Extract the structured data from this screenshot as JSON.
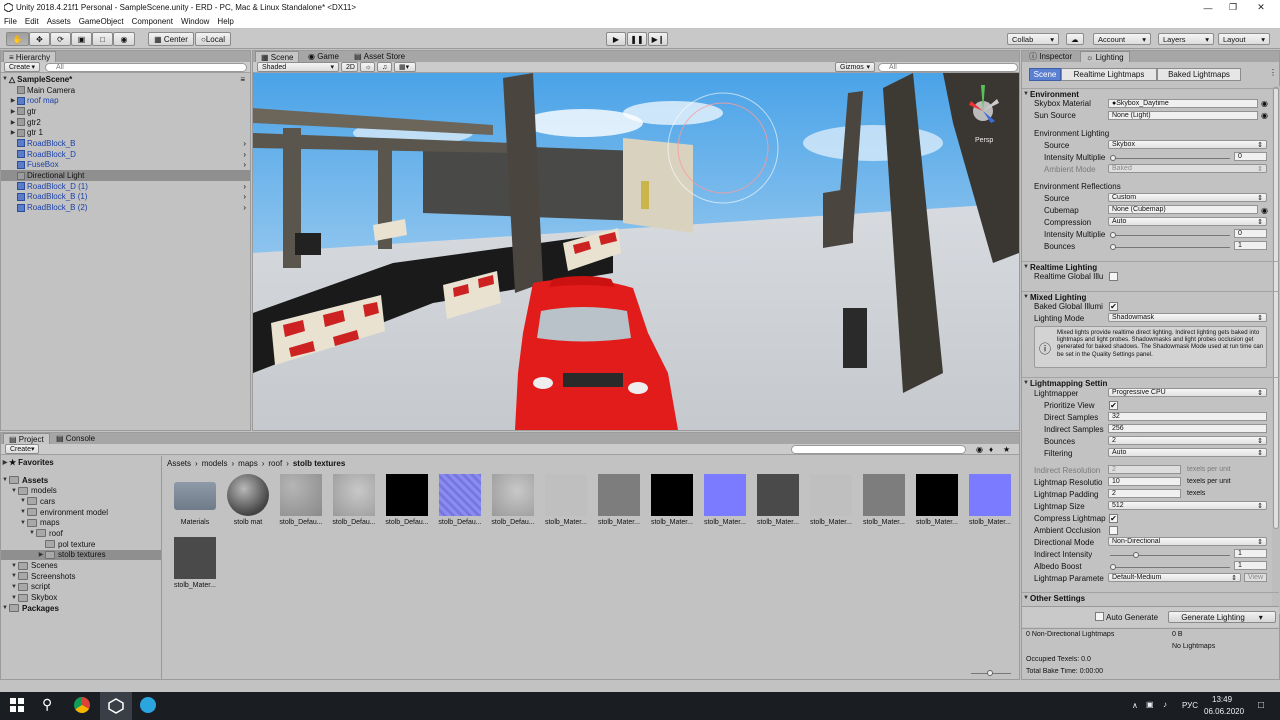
{
  "window": {
    "title": "Unity 2018.4.21f1 Personal - SampleScene.unity - ERD - PC, Mac & Linux Standalone* <DX11>"
  },
  "menu": [
    "File",
    "Edit",
    "Assets",
    "GameObject",
    "Component",
    "Window",
    "Help"
  ],
  "toolbar": {
    "pivot": "Center",
    "space": "Local",
    "collab": "Collab",
    "account": "Account",
    "layers": "Layers",
    "layout": "Layout"
  },
  "hierarchy": {
    "tab": "Hierarchy",
    "create": "Create",
    "search_placeholder": "All",
    "scene": "SampleScene*",
    "items": [
      {
        "label": "Main Camera",
        "type": "object",
        "arrow": false,
        "chevron": false
      },
      {
        "label": "roof map",
        "type": "prefab",
        "arrow": true,
        "chevron": false
      },
      {
        "label": "gtr",
        "type": "object",
        "arrow": true,
        "chevron": false
      },
      {
        "label": "gtr2",
        "type": "object",
        "arrow": true,
        "chevron": false
      },
      {
        "label": "gtr 1",
        "type": "object",
        "arrow": true,
        "chevron": false
      },
      {
        "label": "RoadBlock_B",
        "type": "prefab",
        "arrow": false,
        "chevron": true
      },
      {
        "label": "RoadBlock_D",
        "type": "prefab",
        "arrow": false,
        "chevron": true
      },
      {
        "label": "FuseBox",
        "type": "prefab",
        "arrow": false,
        "chevron": true
      },
      {
        "label": "Directional Light",
        "type": "object",
        "arrow": false,
        "chevron": false,
        "selected": true
      },
      {
        "label": "RoadBlock_D (1)",
        "type": "prefab",
        "arrow": false,
        "chevron": true
      },
      {
        "label": "RoadBlock_B (1)",
        "type": "prefab",
        "arrow": false,
        "chevron": true
      },
      {
        "label": "RoadBlock_B (2)",
        "type": "prefab",
        "arrow": false,
        "chevron": true
      }
    ]
  },
  "scene_view": {
    "tabs": [
      "Scene",
      "Game",
      "Asset Store"
    ],
    "shading": "Shaded",
    "mode_2d": "2D",
    "gizmos": "Gizmos",
    "search_placeholder": "All",
    "persp": "Persp"
  },
  "project": {
    "tabs": [
      "Project",
      "Console"
    ],
    "create": "Create",
    "favorites": "Favorites",
    "tree": [
      {
        "label": "Assets",
        "depth": 0,
        "bold": true
      },
      {
        "label": "models",
        "depth": 1
      },
      {
        "label": "cars",
        "depth": 2
      },
      {
        "label": "environment model",
        "depth": 2
      },
      {
        "label": "maps",
        "depth": 2
      },
      {
        "label": "roof",
        "depth": 3
      },
      {
        "label": "pol texture",
        "depth": 4
      },
      {
        "label": "stolb textures",
        "depth": 4,
        "selected": true
      },
      {
        "label": "Scenes",
        "depth": 1
      },
      {
        "label": "Screenshots",
        "depth": 1
      },
      {
        "label": "script",
        "depth": 1
      },
      {
        "label": "Skybox",
        "depth": 1
      },
      {
        "label": "Packages",
        "depth": 0,
        "bold": true
      }
    ],
    "breadcrumb": [
      "Assets",
      "models",
      "maps",
      "roof",
      "stolb textures"
    ],
    "assets": [
      {
        "label": "Materials",
        "kind": "folder"
      },
      {
        "label": "stolb mat",
        "kind": "sphere"
      },
      {
        "label": "stolb_Defau...",
        "kind": "tx"
      },
      {
        "label": "stolb_Defau...",
        "kind": "tx2"
      },
      {
        "label": "stolb_Defau...",
        "kind": "blk"
      },
      {
        "label": "stolb_Defau...",
        "kind": "nrmt"
      },
      {
        "label": "stolb_Defau...",
        "kind": "tx2"
      },
      {
        "label": "stolb_Mater...",
        "kind": "lg"
      },
      {
        "label": "stolb_Mater...",
        "kind": "mg"
      },
      {
        "label": "stolb_Mater...",
        "kind": "blk"
      },
      {
        "label": "stolb_Mater...",
        "kind": "nrm"
      },
      {
        "label": "stolb_Mater...",
        "kind": "dg"
      },
      {
        "label": "stolb_Mater...",
        "kind": "lg"
      },
      {
        "label": "stolb_Mater...",
        "kind": "mg"
      },
      {
        "label": "stolb_Mater...",
        "kind": "blk"
      },
      {
        "label": "stolb_Mater...",
        "kind": "nrm"
      },
      {
        "label": "stolb_Mater...",
        "kind": "dg"
      }
    ]
  },
  "inspector": {
    "tabs": [
      "Inspector",
      "Lighting"
    ],
    "subtabs": [
      "Scene",
      "Realtime Lightmaps",
      "Baked Lightmaps"
    ],
    "environment": {
      "header": "Environment",
      "skybox_label": "Skybox Material",
      "skybox_value": "Skybox_Daytime",
      "sun_label": "Sun Source",
      "sun_value": "None (Light)",
      "env_lighting": "Environment Lighting",
      "source_label": "Source",
      "source_value": "Skybox",
      "intensity_label": "Intensity Multiplie",
      "intensity_value": "0",
      "intensity_level": 0.0,
      "ambient_label": "Ambient Mode",
      "ambient_value": "Baked",
      "env_reflections": "Environment Reflections",
      "refl_source_label": "Source",
      "refl_source_value": "Custom",
      "cubemap_label": "Cubemap",
      "cubemap_value": "None (Cubemap)",
      "compression_label": "Compression",
      "compression_value": "Auto",
      "refl_intensity_label": "Intensity Multiplie",
      "refl_intensity_value": "0",
      "refl_intensity_level": 0.0,
      "bounces_label": "Bounces",
      "bounces_value": "1",
      "bounces_level": 0.0
    },
    "realtime": {
      "header": "Realtime Lighting",
      "gi_label": "Realtime Global Illu",
      "gi_checked": false
    },
    "mixed": {
      "header": "Mixed Lighting",
      "baked_label": "Baked Global Illumi",
      "baked_checked": true,
      "mode_label": "Lighting Mode",
      "mode_value": "Shadowmask",
      "info": "Mixed lights provide realtime direct lighting. Indirect lighting gets baked into lightmaps and light probes. Shadowmasks and light probes occlusion get generated for baked shadows. The Shadowmask Mode used at run time can be set in the Quality Settings panel."
    },
    "lightmapping": {
      "header": "Lightmapping Settin",
      "lightmapper_label": "Lightmapper",
      "lightmapper_value": "Progressive CPU",
      "prioritize_label": "Prioritize View",
      "prioritize_checked": true,
      "direct_label": "Direct Samples",
      "direct_value": "32",
      "indirect_label": "Indirect Samples",
      "indirect_value": "256",
      "bounces_label": "Bounces",
      "bounces_value": "2",
      "filtering_label": "Filtering",
      "filtering_value": "Auto",
      "ind_res_label": "Indirect Resolution",
      "ind_res_value": "2",
      "ind_res_unit": "texels per unit",
      "lm_res_label": "Lightmap Resolutio",
      "lm_res_value": "10",
      "lm_res_unit": "texels per unit",
      "padding_label": "Lightmap Padding",
      "padding_value": "2",
      "padding_unit": "texels",
      "size_label": "Lightmap Size",
      "size_value": "512",
      "compress_label": "Compress Lightmap",
      "compress_checked": true,
      "ao_label": "Ambient Occlusion",
      "ao_checked": false,
      "dir_mode_label": "Directional Mode",
      "dir_mode_value": "Non-Directional",
      "ind_int_label": "Indirect Intensity",
      "ind_int_value": "1",
      "ind_int_level": 0.2,
      "albedo_label": "Albedo Boost",
      "albedo_value": "1",
      "albedo_level": 0.0,
      "params_label": "Lightmap Paramete",
      "params_value": "Default-Medium",
      "view_btn": "View"
    },
    "other": {
      "header": "Other Settings"
    },
    "auto_generate_label": "Auto Generate",
    "auto_generate_checked": false,
    "generate_btn": "Generate Lighting",
    "stats": {
      "lightmaps": "0 Non-Directional Lightmaps",
      "size": "0 B",
      "none": "No Lightmaps",
      "texels": "Occupied Texels: 0.0",
      "bake_time": "Total Bake Time: 0:00:00"
    }
  },
  "taskbar": {
    "lang": "РУС",
    "time": "13:49",
    "date": "06.06.2020"
  }
}
